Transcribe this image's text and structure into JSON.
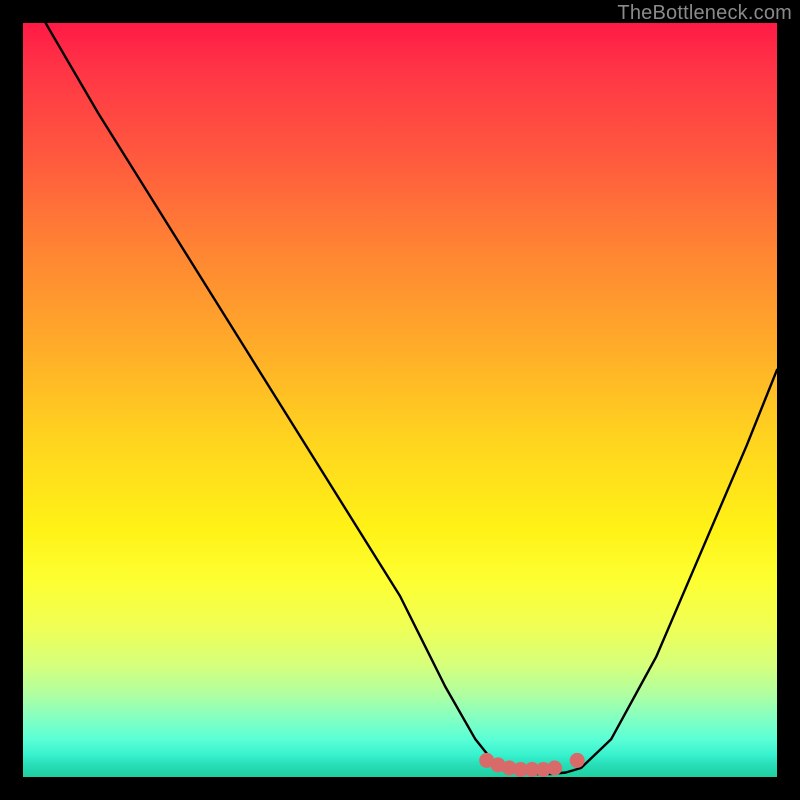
{
  "watermark": "TheBottleneck.com",
  "chart_data": {
    "type": "line",
    "title": "",
    "xlabel": "",
    "ylabel": "",
    "xlim": [
      0,
      100
    ],
    "ylim": [
      0,
      100
    ],
    "series": [
      {
        "name": "curve",
        "x": [
          3,
          10,
          20,
          30,
          40,
          50,
          56,
          60,
          62,
          64,
          66,
          68,
          70,
          72,
          74,
          78,
          84,
          90,
          96,
          100
        ],
        "y": [
          100,
          88,
          72,
          56,
          40,
          24,
          12,
          5,
          2.5,
          1.2,
          0.6,
          0.4,
          0.4,
          0.6,
          1.2,
          5,
          16,
          30,
          44,
          54
        ]
      }
    ],
    "markers": {
      "name": "baseline-dots",
      "color": "#d96a6a",
      "x": [
        61.5,
        63,
        64.5,
        66,
        67.5,
        69,
        70.5,
        73.5
      ],
      "y": [
        2.2,
        1.6,
        1.2,
        1.0,
        1.0,
        1.0,
        1.2,
        2.2
      ]
    },
    "gradient_stops": [
      {
        "pos": 0,
        "color": "#ff1a45"
      },
      {
        "pos": 0.5,
        "color": "#ffd31f"
      },
      {
        "pos": 0.8,
        "color": "#f0ff55"
      },
      {
        "pos": 1.0,
        "color": "#1fcf9f"
      }
    ]
  }
}
